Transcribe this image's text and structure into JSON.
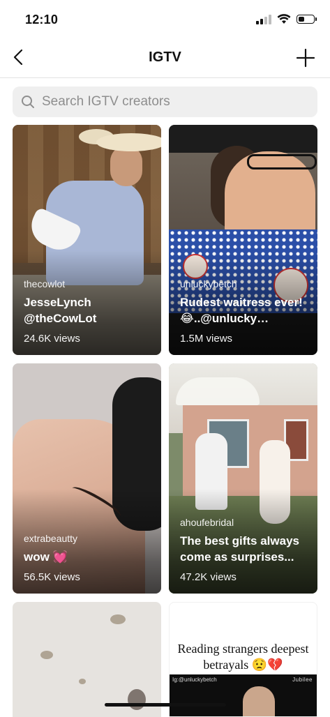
{
  "status_bar": {
    "time": "12:10",
    "signal_bars": 2,
    "battery_level": 0.35
  },
  "nav": {
    "title": "IGTV",
    "back_icon": "chevron-left-icon",
    "add_icon": "plus-icon"
  },
  "search": {
    "placeholder": "Search IGTV creators",
    "icon": "search-icon"
  },
  "videos": [
    {
      "creator": "thecowlot",
      "title": "JesseLynch @theCowLot",
      "views": "24.6K views"
    },
    {
      "creator": "unluckybetch",
      "title": "Rudest waitress ever!😂..@unlucky…",
      "views": "1.5M views"
    },
    {
      "creator": "extrabeautty",
      "title": "wow 💓",
      "views": "56.5K views"
    },
    {
      "creator": "ahoufebridal",
      "title": "The best gifts always come as surprises...",
      "views": "47.2K views"
    },
    {
      "creator": "",
      "title": "",
      "views": ""
    },
    {
      "caption": "Reading strangers deepest betrayals 😟💔",
      "watermark": "Ig:@unluckybetch",
      "brand": "Jubilee"
    }
  ],
  "colors": {
    "background": "#ffffff",
    "search_bg": "#efefef",
    "text": "#111111",
    "muted": "#8e8e8e"
  }
}
